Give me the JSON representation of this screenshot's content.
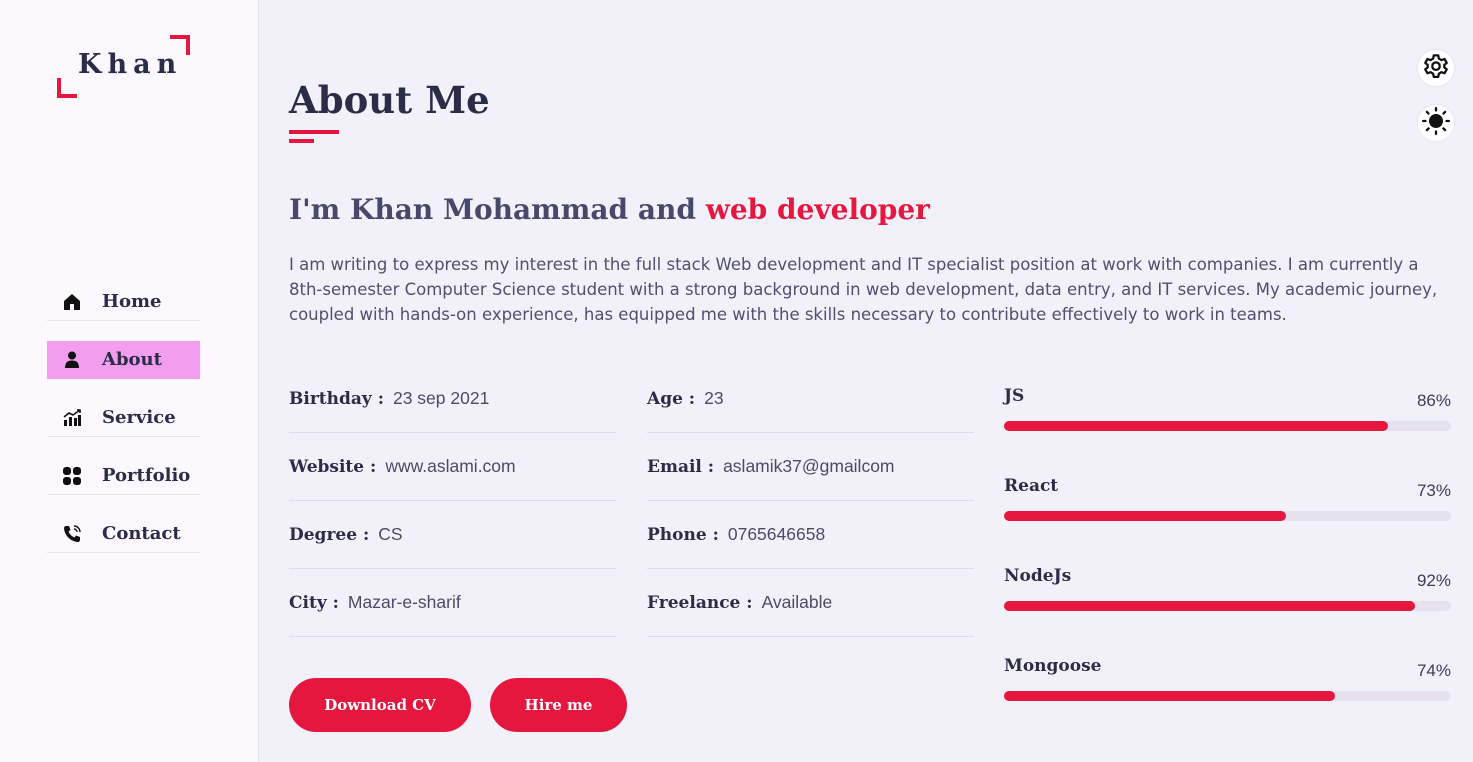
{
  "logo": {
    "text": "Khan"
  },
  "nav": {
    "items": [
      {
        "label": "Home",
        "icon": "home-icon",
        "active": false
      },
      {
        "label": "About",
        "icon": "user-icon",
        "active": true
      },
      {
        "label": "Service",
        "icon": "chart-icon",
        "active": false
      },
      {
        "label": "Portfolio",
        "icon": "grid-icon",
        "active": false
      },
      {
        "label": "Contact",
        "icon": "phone-icon",
        "active": false
      }
    ]
  },
  "page": {
    "title": "About Me"
  },
  "headline": {
    "prefix": "I'm Khan Mohammad and ",
    "accent": "web developer"
  },
  "intro": "I am writing to express my interest in the full stack Web development and IT specialist position at work with companies. I am currently a 8th-semester Computer Science student with a strong background in web development, data entry, and IT services. My academic journey, coupled with hands-on experience, has equipped me with the skills necessary to contribute effectively to work in teams.",
  "info": {
    "col1": [
      {
        "label": "Birthday :",
        "value": "23 sep 2021"
      },
      {
        "label": "Website :",
        "value": "www.aslami.com"
      },
      {
        "label": "Degree :",
        "value": "CS"
      },
      {
        "label": "City :",
        "value": "Mazar-e-sharif"
      }
    ],
    "col2": [
      {
        "label": "Age :",
        "value": "23"
      },
      {
        "label": "Email :",
        "value": "aslamik37@gmailcom"
      },
      {
        "label": "Phone :",
        "value": "0765646658"
      },
      {
        "label": "Freelance :",
        "value": "Available"
      }
    ]
  },
  "skills": [
    {
      "name": "JS",
      "percent_label": "86%",
      "level": 0.86
    },
    {
      "name": "React",
      "percent_label": "73%",
      "level": 0.63
    },
    {
      "name": "NodeJs",
      "percent_label": "92%",
      "level": 0.92
    },
    {
      "name": "Mongoose",
      "percent_label": "74%",
      "level": 0.74
    }
  ],
  "buttons": {
    "download": "Download CV",
    "hire": "Hire me"
  },
  "controls": {
    "settings_icon": "gear-icon",
    "theme_icon": "sun-icon"
  },
  "colors": {
    "accent": "#e5173f",
    "active_nav": "#f29dee",
    "text": "#2b2c45"
  }
}
